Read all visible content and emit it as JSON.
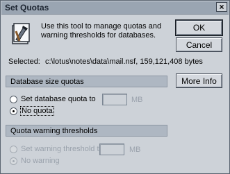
{
  "window": {
    "title": "Set Quotas",
    "close_glyph": "×"
  },
  "header": {
    "icon": "tool-icon",
    "description": "Use this tool to manage quotas and warning thresholds for databases."
  },
  "buttons": {
    "ok": "OK",
    "cancel": "Cancel",
    "more_info": "More Info"
  },
  "selected": {
    "label": "Selected:",
    "value": "c:\\lotus\\notes\\data\\mail.nsf, 159,121,408 bytes"
  },
  "size_quotas": {
    "heading": "Database size quotas",
    "set_label": "Set database quota to",
    "quota_value": "",
    "unit": "MB",
    "no_quota_label": "No quota",
    "selected_option": "No quota"
  },
  "warning_thresholds": {
    "heading": "Quota warning thresholds",
    "set_label": "Set warning threshold to",
    "threshold_value": "",
    "unit": "MB",
    "no_warning_label": "No warning",
    "selected_option": "No warning",
    "enabled": false
  },
  "colors": {
    "dialog_bg": "#cdd2d8",
    "section_bg": "#aeb7c2",
    "titlebar_bg": "#9aa5b2"
  }
}
